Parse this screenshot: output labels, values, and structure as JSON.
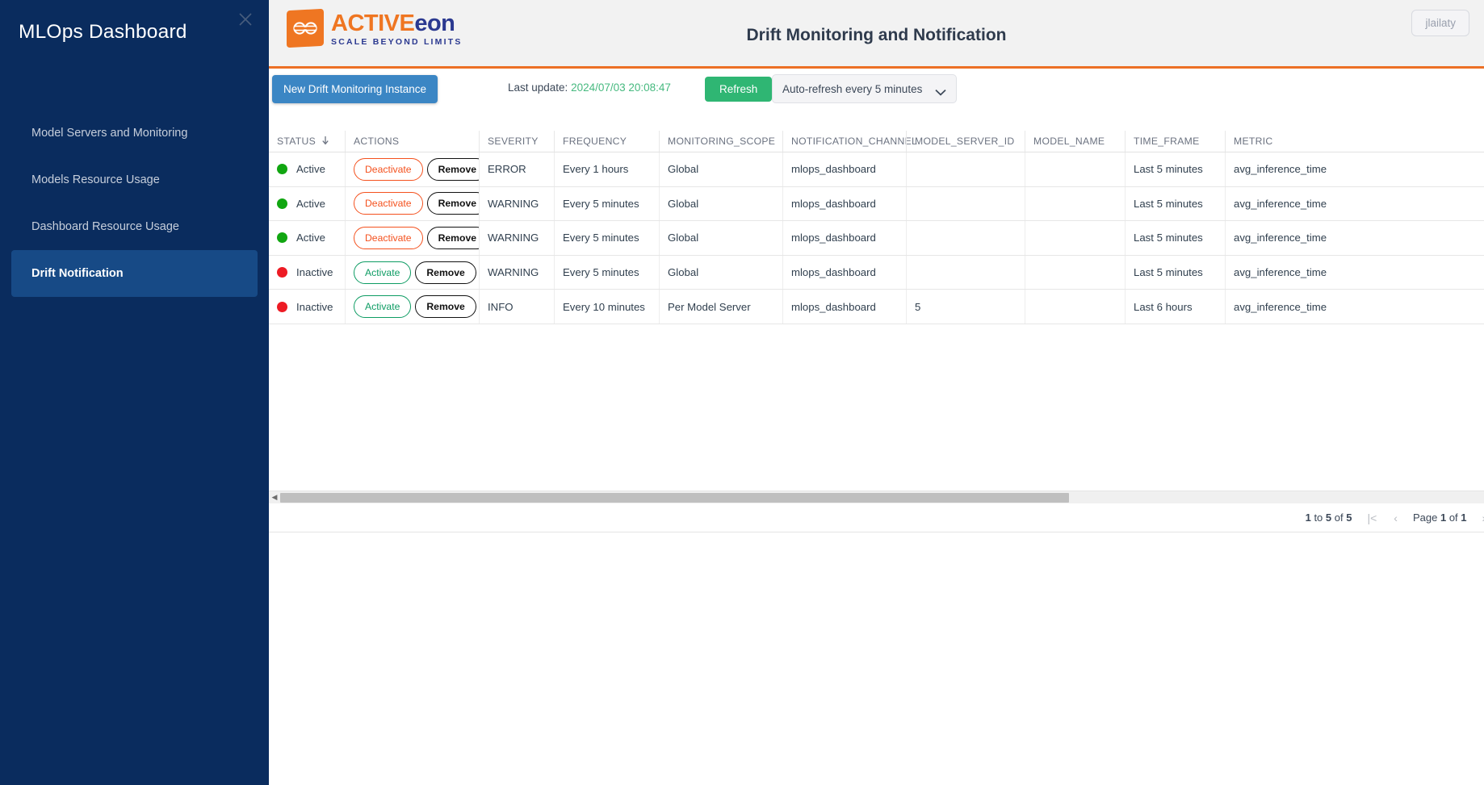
{
  "sidebar": {
    "title": "MLOps Dashboard",
    "close_icon": "close-icon",
    "items": [
      {
        "label": "Model Servers and Monitoring",
        "active": false
      },
      {
        "label": "Models Resource Usage",
        "active": false
      },
      {
        "label": "Dashboard Resource Usage",
        "active": false
      },
      {
        "label": "Drift Notification",
        "active": true
      }
    ]
  },
  "header": {
    "logo": {
      "icon": "activeeon-infinity-logo",
      "word_primary": "ACTIVE",
      "word_secondary": "eon",
      "tagline": "SCALE BEYOND LIMITS"
    },
    "title": "Drift Monitoring and Notification",
    "user": "jlailaty"
  },
  "toolbar": {
    "new_instance_label": "New Drift Monitoring Instance",
    "last_update_label": "Last update:",
    "last_update_value": "2024/07/03 20:08:47",
    "refresh_label": "Refresh",
    "auto_refresh_selected": "Auto-refresh every 5 minutes",
    "auto_refresh_options": [
      "Auto-refresh every 5 minutes"
    ]
  },
  "table": {
    "sort_column": "STATUS",
    "sort_direction": "desc",
    "columns": [
      {
        "key": "status",
        "label": "STATUS"
      },
      {
        "key": "actions",
        "label": "ACTIONS"
      },
      {
        "key": "severity",
        "label": "SEVERITY"
      },
      {
        "key": "frequency",
        "label": "FREQUENCY"
      },
      {
        "key": "scope",
        "label": "MONITORING_SCOPE"
      },
      {
        "key": "channel",
        "label": "NOTIFICATION_CHANNEL"
      },
      {
        "key": "model_server_id",
        "label": "MODEL_SERVER_ID"
      },
      {
        "key": "model_name",
        "label": "MODEL_NAME"
      },
      {
        "key": "time_frame",
        "label": "TIME_FRAME"
      },
      {
        "key": "metric",
        "label": "METRIC"
      }
    ],
    "rows": [
      {
        "status": "Active",
        "status_color": "green",
        "primary_action": "Deactivate",
        "remove_action": "Remove",
        "severity": "ERROR",
        "frequency": "Every 1 hours",
        "scope": "Global",
        "channel": "mlops_dashboard",
        "model_server_id": "",
        "model_name": "",
        "time_frame": "Last 5 minutes",
        "metric": "avg_inference_time"
      },
      {
        "status": "Active",
        "status_color": "green",
        "primary_action": "Deactivate",
        "remove_action": "Remove",
        "severity": "WARNING",
        "frequency": "Every 5 minutes",
        "scope": "Global",
        "channel": "mlops_dashboard",
        "model_server_id": "",
        "model_name": "",
        "time_frame": "Last 5 minutes",
        "metric": "avg_inference_time"
      },
      {
        "status": "Active",
        "status_color": "green",
        "primary_action": "Deactivate",
        "remove_action": "Remove",
        "severity": "WARNING",
        "frequency": "Every 5 minutes",
        "scope": "Global",
        "channel": "mlops_dashboard",
        "model_server_id": "",
        "model_name": "",
        "time_frame": "Last 5 minutes",
        "metric": "avg_inference_time"
      },
      {
        "status": "Inactive",
        "status_color": "red",
        "primary_action": "Activate",
        "remove_action": "Remove",
        "severity": "WARNING",
        "frequency": "Every 5 minutes",
        "scope": "Global",
        "channel": "mlops_dashboard",
        "model_server_id": "",
        "model_name": "",
        "time_frame": "Last 5 minutes",
        "metric": "avg_inference_time"
      },
      {
        "status": "Inactive",
        "status_color": "red",
        "primary_action": "Activate",
        "remove_action": "Remove",
        "severity": "INFO",
        "frequency": "Every 10 minutes",
        "scope": "Per Model Server",
        "channel": "mlops_dashboard",
        "model_server_id": "5",
        "model_name": "",
        "time_frame": "Last 6 hours",
        "metric": "avg_inference_time"
      }
    ]
  },
  "pagination": {
    "range_prefix": "1",
    "range_middle": "to",
    "range_to": "5",
    "range_of": "of",
    "range_total": "5",
    "first_icon": "|<",
    "prev_icon": "‹",
    "page_label": "Page",
    "page_current": "1",
    "page_of": "of",
    "page_total": "1",
    "next_icon": "›",
    "last_icon": ">|"
  },
  "colors": {
    "sidebar_bg": "#0a2c5e",
    "sidebar_active": "#174a86",
    "accent_orange": "#ec7025",
    "brand_orange": "#ef7622",
    "brand_blue": "#2b3990",
    "primary_button": "#3b86c4",
    "refresh_green": "#2fb673",
    "status_active": "#11a611",
    "status_inactive": "#ed1b24",
    "deactivate": "#f4511e",
    "activate": "#0d9c63"
  }
}
